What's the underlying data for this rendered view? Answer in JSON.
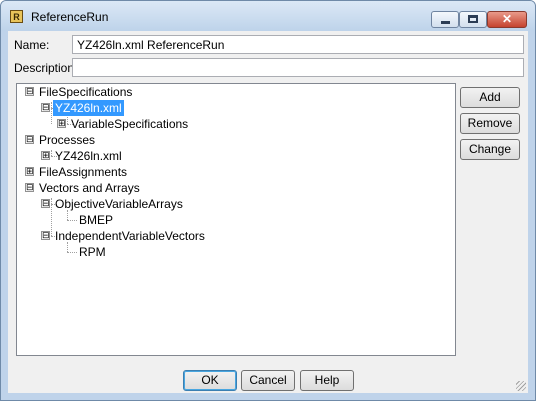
{
  "window": {
    "title": "ReferenceRun",
    "title_icon": "run-app-icon",
    "minimize_glyph": "minimize-icon",
    "maximize_glyph": "maximize-icon",
    "close_glyph": "✕"
  },
  "form": {
    "name_label": "Name:",
    "name_value": "YZ426ln.xml ReferenceRun",
    "description_label": "Description:",
    "description_value": ""
  },
  "tree": {
    "nodes": [
      {
        "label": "FileSpecifications",
        "expander": "⊟",
        "selected": false
      },
      {
        "label": "YZ426ln.xml",
        "expander": "⊟",
        "selected": true
      },
      {
        "label": "VariableSpecifications",
        "expander": "⊞",
        "selected": false
      },
      {
        "label": "Processes",
        "expander": "⊟",
        "selected": false
      },
      {
        "label": "YZ426ln.xml",
        "expander": "⊞",
        "selected": false
      },
      {
        "label": "FileAssignments",
        "expander": "⊞",
        "selected": false
      },
      {
        "label": "Vectors and Arrays",
        "expander": "⊟",
        "selected": false
      },
      {
        "label": "ObjectiveVariableArrays",
        "expander": "⊟",
        "selected": false
      },
      {
        "label": "BMEP",
        "expander": "",
        "selected": false
      },
      {
        "label": "IndependentVariableVectors",
        "expander": "⊟",
        "selected": false
      },
      {
        "label": "RPM",
        "expander": "",
        "selected": false
      }
    ]
  },
  "side_buttons": {
    "add": "Add",
    "remove": "Remove",
    "change": "Change"
  },
  "footer_buttons": {
    "ok": "OK",
    "cancel": "Cancel",
    "help": "Help"
  },
  "colors": {
    "selection": "#3399ff",
    "title_bar": "#bed3ea",
    "close_button": "#c5432f"
  }
}
